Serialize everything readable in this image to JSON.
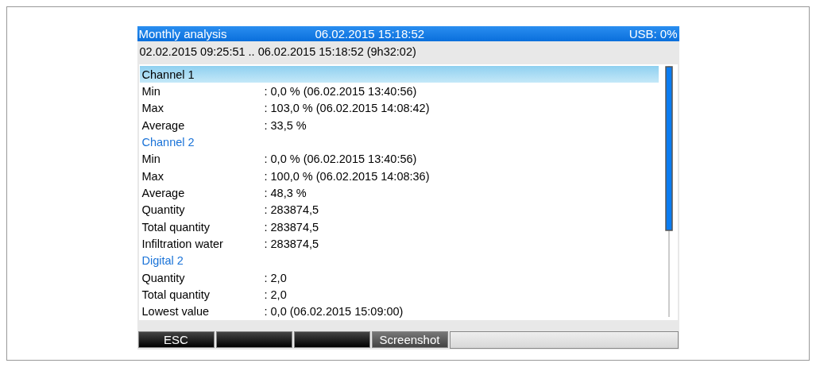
{
  "title_bar": {
    "title": "Monthly analysis",
    "datetime": "06.02.2015 15:18:52",
    "usb": "USB: 0%"
  },
  "period": "02.02.2015 09:25:51 .. 06.02.2015 15:18:52 (9h32:02)",
  "items": [
    {
      "kind": "heading",
      "label": "Channel 1",
      "selected": true
    },
    {
      "kind": "value",
      "label": "Min",
      "value": ": 0,0 % (06.02.2015 13:40:56)"
    },
    {
      "kind": "value",
      "label": "Max",
      "value": ": 103,0 % (06.02.2015 14:08:42)"
    },
    {
      "kind": "value",
      "label": "Average",
      "value": ": 33,5 %"
    },
    {
      "kind": "heading",
      "label": "Channel 2",
      "selected": false
    },
    {
      "kind": "value",
      "label": "Min",
      "value": ": 0,0 % (06.02.2015 13:40:56)"
    },
    {
      "kind": "value",
      "label": "Max",
      "value": ": 100,0 % (06.02.2015 14:08:36)"
    },
    {
      "kind": "value",
      "label": "Average",
      "value": ": 48,3 %"
    },
    {
      "kind": "value",
      "label": "Quantity",
      "value": ": 283874,5"
    },
    {
      "kind": "value",
      "label": "Total quantity",
      "value": ": 283874,5"
    },
    {
      "kind": "value",
      "label": "Infiltration water",
      "value": ": 283874,5"
    },
    {
      "kind": "heading",
      "label": "Digital 2",
      "selected": false
    },
    {
      "kind": "value",
      "label": "Quantity",
      "value": ": 2,0"
    },
    {
      "kind": "value",
      "label": "Total quantity",
      "value": ": 2,0"
    },
    {
      "kind": "value",
      "label": "Lowest value",
      "value": ": 0,0  (06.02.2015 15:09:00)"
    }
  ],
  "softkeys": [
    {
      "kind": "key",
      "label": "ESC"
    },
    {
      "kind": "blank"
    },
    {
      "kind": "blank"
    },
    {
      "kind": "active",
      "label": "Screenshot"
    }
  ]
}
